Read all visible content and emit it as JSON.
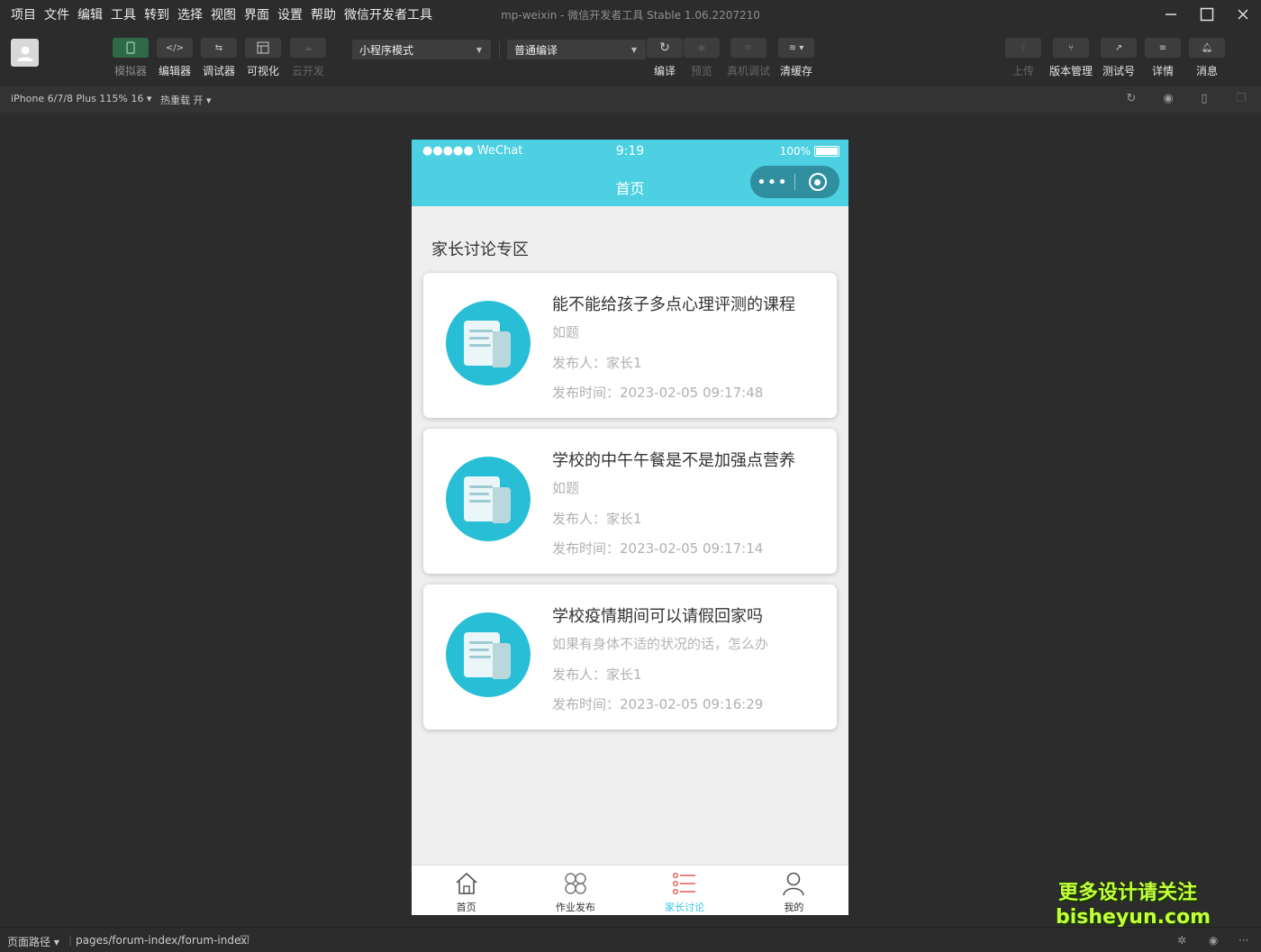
{
  "menu": [
    "项目",
    "文件",
    "编辑",
    "工具",
    "转到",
    "选择",
    "视图",
    "界面",
    "设置",
    "帮助",
    "微信开发者工具"
  ],
  "window": {
    "title": "mp-weixin - 微信开发者工具 Stable 1.06.2207210"
  },
  "toolbar": {
    "simulator": "模拟器",
    "editor": "编辑器",
    "debugger": "调试器",
    "visual": "可视化",
    "cloud": "云开发",
    "mode": "小程序模式",
    "compile_mode": "普通编译",
    "compile": "编译",
    "preview": "预览",
    "real_debug": "真机调试",
    "clear_cache": "清缓存",
    "upload": "上传",
    "version": "版本管理",
    "test_account": "测试号",
    "details": "详情",
    "messages": "消息"
  },
  "subbar": {
    "device": "iPhone 6/7/8 Plus 115% 16 ▾",
    "hot_reload": "热重载 开 ▾"
  },
  "phone": {
    "carrier": "●●●●● WeChat",
    "time": "9:19",
    "battery": "100%",
    "nav_title": "首页",
    "section_title": "家长讨论专区",
    "posts": [
      {
        "title": "能不能给孩子多点心理评测的课程",
        "desc": "如题",
        "author": "发布人：家长1",
        "time": "发布时间：2023-02-05 09:17:48"
      },
      {
        "title": "学校的中午午餐是不是加强点营养",
        "desc": "如题",
        "author": "发布人：家长1",
        "time": "发布时间：2023-02-05 09:17:14"
      },
      {
        "title": "学校疫情期间可以请假回家吗",
        "desc": "如果有身体不适的状况的话，怎么办",
        "author": "发布人：家长1",
        "time": "发布时间：2023-02-05 09:16:29"
      }
    ],
    "tabs": [
      {
        "label": "首页",
        "icon": "home-icon"
      },
      {
        "label": "作业发布",
        "icon": "clover-icon"
      },
      {
        "label": "家长讨论",
        "icon": "list-icon"
      },
      {
        "label": "我的",
        "icon": "user-icon"
      }
    ],
    "active_tab": 2
  },
  "watermark": {
    "line1": "更多设计请关注",
    "line2": "bisheyun.com"
  },
  "bottombar": {
    "path_label": "页面路径 ▾",
    "path": "pages/forum-index/forum-index"
  },
  "colors": {
    "accent": "#4dd0e1",
    "icon_circle": "#28bfd6",
    "active_tab": "#38c8e0",
    "brand_green": "#2f6a48"
  }
}
